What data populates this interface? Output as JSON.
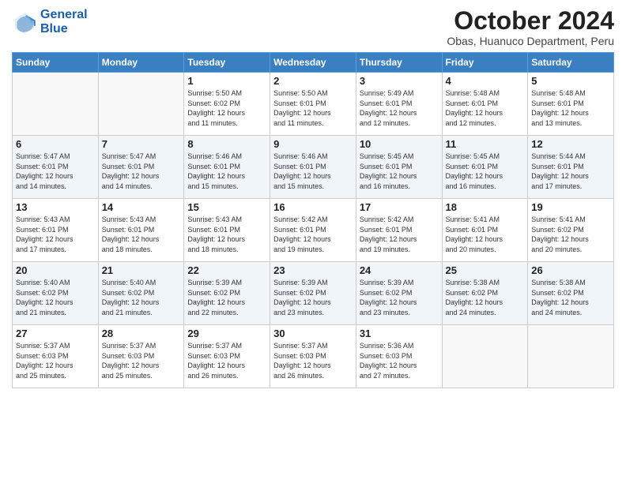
{
  "header": {
    "logo_line1": "General",
    "logo_line2": "Blue",
    "month": "October 2024",
    "location": "Obas, Huanuco Department, Peru"
  },
  "weekdays": [
    "Sunday",
    "Monday",
    "Tuesday",
    "Wednesday",
    "Thursday",
    "Friday",
    "Saturday"
  ],
  "weeks": [
    [
      {
        "day": "",
        "info": ""
      },
      {
        "day": "",
        "info": ""
      },
      {
        "day": "1",
        "info": "Sunrise: 5:50 AM\nSunset: 6:02 PM\nDaylight: 12 hours\nand 11 minutes."
      },
      {
        "day": "2",
        "info": "Sunrise: 5:50 AM\nSunset: 6:01 PM\nDaylight: 12 hours\nand 11 minutes."
      },
      {
        "day": "3",
        "info": "Sunrise: 5:49 AM\nSunset: 6:01 PM\nDaylight: 12 hours\nand 12 minutes."
      },
      {
        "day": "4",
        "info": "Sunrise: 5:48 AM\nSunset: 6:01 PM\nDaylight: 12 hours\nand 12 minutes."
      },
      {
        "day": "5",
        "info": "Sunrise: 5:48 AM\nSunset: 6:01 PM\nDaylight: 12 hours\nand 13 minutes."
      }
    ],
    [
      {
        "day": "6",
        "info": "Sunrise: 5:47 AM\nSunset: 6:01 PM\nDaylight: 12 hours\nand 14 minutes."
      },
      {
        "day": "7",
        "info": "Sunrise: 5:47 AM\nSunset: 6:01 PM\nDaylight: 12 hours\nand 14 minutes."
      },
      {
        "day": "8",
        "info": "Sunrise: 5:46 AM\nSunset: 6:01 PM\nDaylight: 12 hours\nand 15 minutes."
      },
      {
        "day": "9",
        "info": "Sunrise: 5:46 AM\nSunset: 6:01 PM\nDaylight: 12 hours\nand 15 minutes."
      },
      {
        "day": "10",
        "info": "Sunrise: 5:45 AM\nSunset: 6:01 PM\nDaylight: 12 hours\nand 16 minutes."
      },
      {
        "day": "11",
        "info": "Sunrise: 5:45 AM\nSunset: 6:01 PM\nDaylight: 12 hours\nand 16 minutes."
      },
      {
        "day": "12",
        "info": "Sunrise: 5:44 AM\nSunset: 6:01 PM\nDaylight: 12 hours\nand 17 minutes."
      }
    ],
    [
      {
        "day": "13",
        "info": "Sunrise: 5:43 AM\nSunset: 6:01 PM\nDaylight: 12 hours\nand 17 minutes."
      },
      {
        "day": "14",
        "info": "Sunrise: 5:43 AM\nSunset: 6:01 PM\nDaylight: 12 hours\nand 18 minutes."
      },
      {
        "day": "15",
        "info": "Sunrise: 5:43 AM\nSunset: 6:01 PM\nDaylight: 12 hours\nand 18 minutes."
      },
      {
        "day": "16",
        "info": "Sunrise: 5:42 AM\nSunset: 6:01 PM\nDaylight: 12 hours\nand 19 minutes."
      },
      {
        "day": "17",
        "info": "Sunrise: 5:42 AM\nSunset: 6:01 PM\nDaylight: 12 hours\nand 19 minutes."
      },
      {
        "day": "18",
        "info": "Sunrise: 5:41 AM\nSunset: 6:01 PM\nDaylight: 12 hours\nand 20 minutes."
      },
      {
        "day": "19",
        "info": "Sunrise: 5:41 AM\nSunset: 6:02 PM\nDaylight: 12 hours\nand 20 minutes."
      }
    ],
    [
      {
        "day": "20",
        "info": "Sunrise: 5:40 AM\nSunset: 6:02 PM\nDaylight: 12 hours\nand 21 minutes."
      },
      {
        "day": "21",
        "info": "Sunrise: 5:40 AM\nSunset: 6:02 PM\nDaylight: 12 hours\nand 21 minutes."
      },
      {
        "day": "22",
        "info": "Sunrise: 5:39 AM\nSunset: 6:02 PM\nDaylight: 12 hours\nand 22 minutes."
      },
      {
        "day": "23",
        "info": "Sunrise: 5:39 AM\nSunset: 6:02 PM\nDaylight: 12 hours\nand 23 minutes."
      },
      {
        "day": "24",
        "info": "Sunrise: 5:39 AM\nSunset: 6:02 PM\nDaylight: 12 hours\nand 23 minutes."
      },
      {
        "day": "25",
        "info": "Sunrise: 5:38 AM\nSunset: 6:02 PM\nDaylight: 12 hours\nand 24 minutes."
      },
      {
        "day": "26",
        "info": "Sunrise: 5:38 AM\nSunset: 6:02 PM\nDaylight: 12 hours\nand 24 minutes."
      }
    ],
    [
      {
        "day": "27",
        "info": "Sunrise: 5:37 AM\nSunset: 6:03 PM\nDaylight: 12 hours\nand 25 minutes."
      },
      {
        "day": "28",
        "info": "Sunrise: 5:37 AM\nSunset: 6:03 PM\nDaylight: 12 hours\nand 25 minutes."
      },
      {
        "day": "29",
        "info": "Sunrise: 5:37 AM\nSunset: 6:03 PM\nDaylight: 12 hours\nand 26 minutes."
      },
      {
        "day": "30",
        "info": "Sunrise: 5:37 AM\nSunset: 6:03 PM\nDaylight: 12 hours\nand 26 minutes."
      },
      {
        "day": "31",
        "info": "Sunrise: 5:36 AM\nSunset: 6:03 PM\nDaylight: 12 hours\nand 27 minutes."
      },
      {
        "day": "",
        "info": ""
      },
      {
        "day": "",
        "info": ""
      }
    ]
  ]
}
